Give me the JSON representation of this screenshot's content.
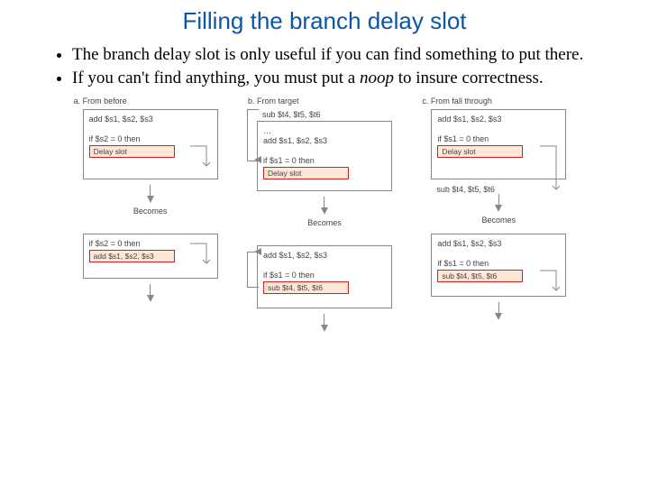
{
  "title": "Filling the branch delay slot",
  "bullets": [
    "The branch delay slot is only useful if you can find something to put there.",
    "If you can't find anything, you must put a noop to insure correctness."
  ],
  "noop_word": "noop",
  "becomes_label": "Becomes",
  "columns": [
    {
      "head": "a.  From before",
      "top_lines": [
        "add $s1, $s2, $s3",
        "",
        "if $s2 = 0 then"
      ],
      "top_slot": "Delay slot",
      "bot_lines": [
        "if $s2 = 0 then"
      ],
      "bot_slot": "add $s1, $s2, $s3"
    },
    {
      "head": "b.  From target",
      "top_pre": "sub $t4, $t5, $t6",
      "top_lines": [
        "add $s1, $s2, $s3",
        "",
        "if $s1 = 0 then"
      ],
      "top_slot": "Delay slot",
      "bot_lines": [
        "add $s1, $s2, $s3",
        "",
        "if $s1 = 0 then"
      ],
      "bot_slot": "sub $t4, $t5, $t6"
    },
    {
      "head": "c.  From fall through",
      "top_lines": [
        "add $s1, $s2, $s3",
        "",
        "if $s1 = 0 then"
      ],
      "top_slot": "Delay slot",
      "top_post": "sub $t4, $t5, $t6",
      "bot_lines": [
        "add $s1, $s2, $s3",
        "",
        "if $s1 = 0 then"
      ],
      "bot_slot": "sub $t4, $t5, $t6"
    }
  ]
}
